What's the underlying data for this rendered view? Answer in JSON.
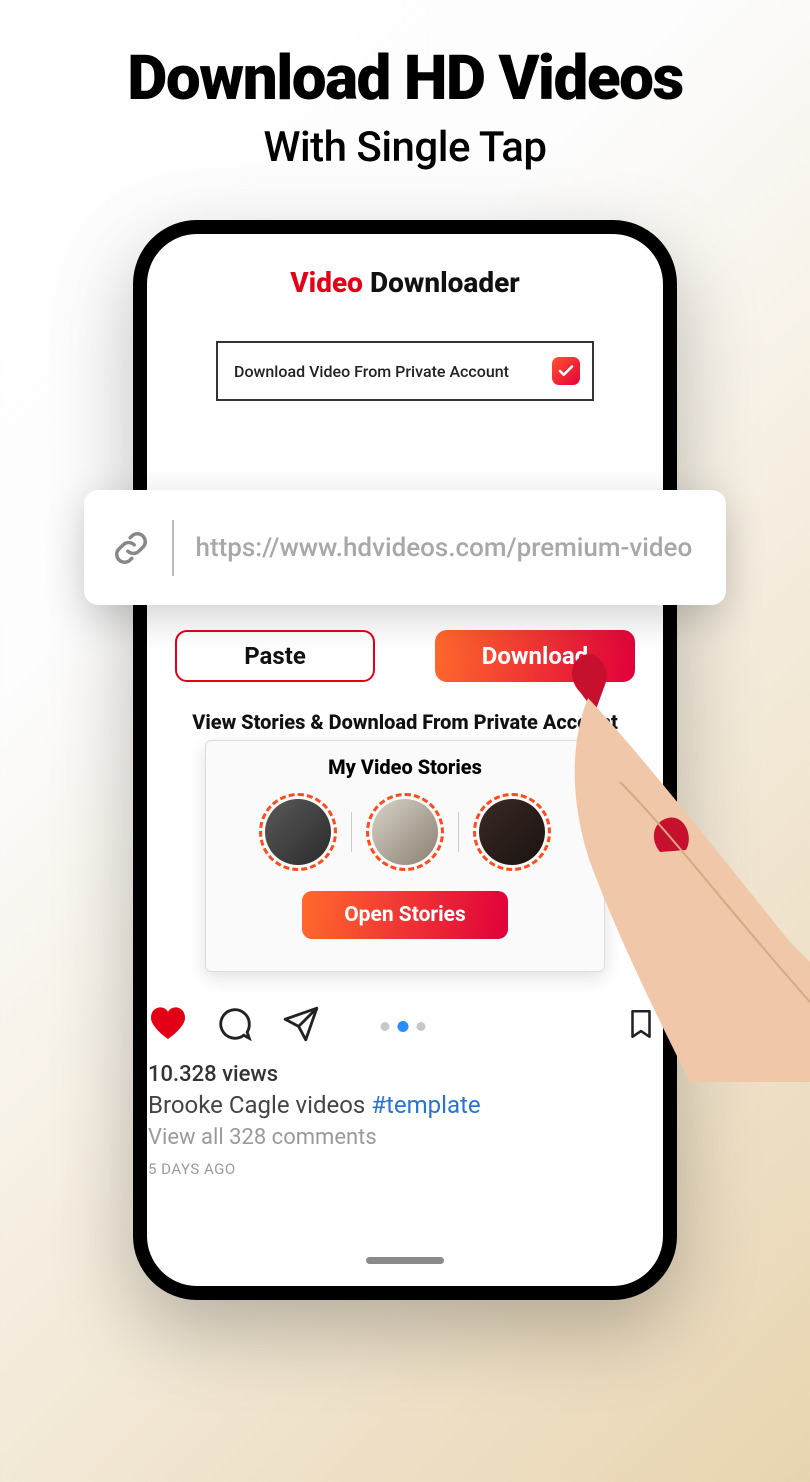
{
  "promo": {
    "title": "Download HD Videos",
    "subtitle": "With Single Tap"
  },
  "app": {
    "title_part1": "Video",
    "title_part2": " Downloader",
    "private_label": "Download Video From Private Account"
  },
  "url_input": {
    "placeholder": "https://www.hdvideos.com/premium-video"
  },
  "buttons": {
    "paste": "Paste",
    "download": "Download",
    "open_stories": "Open Stories"
  },
  "stories": {
    "section_label": "View Stories & Download From Private Account",
    "card_title": "My Video Stories"
  },
  "feed": {
    "views": "10.328 views",
    "author": "Brooke Cagle videos ",
    "tag": "#template",
    "comments": "View all 328 comments",
    "timestamp": "5 DAYS AGO"
  }
}
